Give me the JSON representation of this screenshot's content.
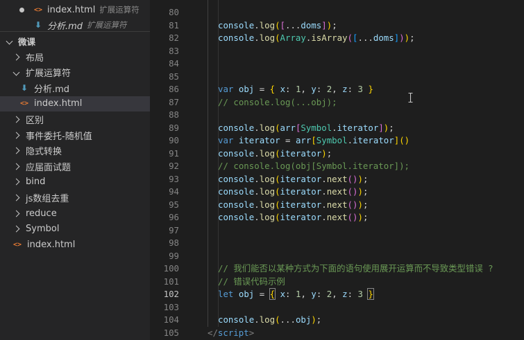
{
  "sidebar": {
    "open_editors": [
      {
        "name": "index.html",
        "description": "扩展运算符",
        "icon": "html-icon",
        "dirty": true
      },
      {
        "name": "分析.md",
        "description": "扩展运算符",
        "icon": "markdown-icon",
        "italic": true
      }
    ],
    "workspace_label": "微课",
    "tree": [
      {
        "label": "布局",
        "type": "folder",
        "expanded": false
      },
      {
        "label": "扩展运算符",
        "type": "folder",
        "expanded": true
      },
      {
        "label": "分析.md",
        "type": "file",
        "icon": "markdown-icon"
      },
      {
        "label": "index.html",
        "type": "file",
        "icon": "html-icon",
        "selected": true
      },
      {
        "label": "区别",
        "type": "folder",
        "expanded": false
      },
      {
        "label": "事件委托-随机值",
        "type": "folder",
        "expanded": false
      },
      {
        "label": "隐式转换",
        "type": "folder",
        "expanded": false
      },
      {
        "label": "应届面试题",
        "type": "folder",
        "expanded": false
      },
      {
        "label": "bind",
        "type": "folder",
        "expanded": false
      },
      {
        "label": "js数组去重",
        "type": "folder",
        "expanded": false
      },
      {
        "label": "reduce",
        "type": "folder",
        "expanded": false
      },
      {
        "label": "Symbol",
        "type": "folder",
        "expanded": false
      },
      {
        "label": "index.html",
        "type": "file",
        "icon": "html-icon"
      }
    ]
  },
  "editor": {
    "active_line": 102,
    "lines": [
      {
        "n": 80,
        "tokens": []
      },
      {
        "n": 81,
        "tokens": [
          [
            "console",
            "var"
          ],
          [
            ".",
            "plain"
          ],
          [
            "log",
            "fn"
          ],
          [
            "(",
            "b1"
          ],
          [
            "[",
            "b2"
          ],
          [
            "...",
            "plain"
          ],
          [
            "doms",
            "var"
          ],
          [
            "]",
            "b2"
          ],
          [
            ")",
            "b1"
          ],
          [
            ";",
            "plain"
          ]
        ]
      },
      {
        "n": 82,
        "tokens": [
          [
            "console",
            "var"
          ],
          [
            ".",
            "plain"
          ],
          [
            "log",
            "fn"
          ],
          [
            "(",
            "b1"
          ],
          [
            "Array",
            "type"
          ],
          [
            ".",
            "plain"
          ],
          [
            "isArray",
            "fn"
          ],
          [
            "(",
            "b2"
          ],
          [
            "[",
            "b3"
          ],
          [
            "...",
            "plain"
          ],
          [
            "doms",
            "var"
          ],
          [
            "]",
            "b3"
          ],
          [
            ")",
            "b2"
          ],
          [
            ")",
            "b1"
          ],
          [
            ";",
            "plain"
          ]
        ]
      },
      {
        "n": 83,
        "tokens": []
      },
      {
        "n": 84,
        "tokens": []
      },
      {
        "n": 85,
        "tokens": []
      },
      {
        "n": 86,
        "tokens": [
          [
            "var",
            "kw"
          ],
          [
            " ",
            "plain"
          ],
          [
            "obj",
            "var"
          ],
          [
            " = ",
            "plain"
          ],
          [
            "{",
            "b1"
          ],
          [
            " ",
            "plain"
          ],
          [
            "x",
            "var"
          ],
          [
            ": ",
            "plain"
          ],
          [
            "1",
            "num"
          ],
          [
            ", ",
            "plain"
          ],
          [
            "y",
            "var"
          ],
          [
            ": ",
            "plain"
          ],
          [
            "2",
            "num"
          ],
          [
            ", ",
            "plain"
          ],
          [
            "z",
            "var"
          ],
          [
            ": ",
            "plain"
          ],
          [
            "3",
            "num"
          ],
          [
            " ",
            "plain"
          ],
          [
            "}",
            "b1"
          ]
        ]
      },
      {
        "n": 87,
        "tokens": [
          [
            "// console.log(...obj);",
            "cm"
          ]
        ]
      },
      {
        "n": 88,
        "tokens": []
      },
      {
        "n": 89,
        "tokens": [
          [
            "console",
            "var"
          ],
          [
            ".",
            "plain"
          ],
          [
            "log",
            "fn"
          ],
          [
            "(",
            "b1"
          ],
          [
            "arr",
            "var"
          ],
          [
            "[",
            "b2"
          ],
          [
            "Symbol",
            "type"
          ],
          [
            ".",
            "plain"
          ],
          [
            "iterator",
            "var"
          ],
          [
            "]",
            "b2"
          ],
          [
            ")",
            "b1"
          ],
          [
            ";",
            "plain"
          ]
        ]
      },
      {
        "n": 90,
        "tokens": [
          [
            "var",
            "kw"
          ],
          [
            " ",
            "plain"
          ],
          [
            "iterator",
            "var"
          ],
          [
            " = ",
            "plain"
          ],
          [
            "arr",
            "var"
          ],
          [
            "[",
            "b1"
          ],
          [
            "Symbol",
            "type"
          ],
          [
            ".",
            "plain"
          ],
          [
            "iterator",
            "var"
          ],
          [
            "]",
            "b1"
          ],
          [
            "(",
            "b1"
          ],
          [
            ")",
            "b1"
          ]
        ]
      },
      {
        "n": 91,
        "tokens": [
          [
            "console",
            "var"
          ],
          [
            ".",
            "plain"
          ],
          [
            "log",
            "fn"
          ],
          [
            "(",
            "b1"
          ],
          [
            "iterator",
            "var"
          ],
          [
            ")",
            "b1"
          ],
          [
            ";",
            "plain"
          ]
        ]
      },
      {
        "n": 92,
        "tokens": [
          [
            "// console.log(obj[Symbol.iterator]);",
            "cm"
          ]
        ]
      },
      {
        "n": 93,
        "tokens": [
          [
            "console",
            "var"
          ],
          [
            ".",
            "plain"
          ],
          [
            "log",
            "fn"
          ],
          [
            "(",
            "b1"
          ],
          [
            "iterator",
            "var"
          ],
          [
            ".",
            "plain"
          ],
          [
            "next",
            "fn"
          ],
          [
            "(",
            "b2"
          ],
          [
            ")",
            "b2"
          ],
          [
            ")",
            "b1"
          ],
          [
            ";",
            "plain"
          ]
        ]
      },
      {
        "n": 94,
        "tokens": [
          [
            "console",
            "var"
          ],
          [
            ".",
            "plain"
          ],
          [
            "log",
            "fn"
          ],
          [
            "(",
            "b1"
          ],
          [
            "iterator",
            "var"
          ],
          [
            ".",
            "plain"
          ],
          [
            "next",
            "fn"
          ],
          [
            "(",
            "b2"
          ],
          [
            ")",
            "b2"
          ],
          [
            ")",
            "b1"
          ],
          [
            ";",
            "plain"
          ]
        ]
      },
      {
        "n": 95,
        "tokens": [
          [
            "console",
            "var"
          ],
          [
            ".",
            "plain"
          ],
          [
            "log",
            "fn"
          ],
          [
            "(",
            "b1"
          ],
          [
            "iterator",
            "var"
          ],
          [
            ".",
            "plain"
          ],
          [
            "next",
            "fn"
          ],
          [
            "(",
            "b2"
          ],
          [
            ")",
            "b2"
          ],
          [
            ")",
            "b1"
          ],
          [
            ";",
            "plain"
          ]
        ]
      },
      {
        "n": 96,
        "tokens": [
          [
            "console",
            "var"
          ],
          [
            ".",
            "plain"
          ],
          [
            "log",
            "fn"
          ],
          [
            "(",
            "b1"
          ],
          [
            "iterator",
            "var"
          ],
          [
            ".",
            "plain"
          ],
          [
            "next",
            "fn"
          ],
          [
            "(",
            "b2"
          ],
          [
            ")",
            "b2"
          ],
          [
            ")",
            "b1"
          ],
          [
            ";",
            "plain"
          ]
        ]
      },
      {
        "n": 97,
        "tokens": []
      },
      {
        "n": 98,
        "tokens": []
      },
      {
        "n": 99,
        "tokens": []
      },
      {
        "n": 100,
        "tokens": [
          [
            "// 我们能否以某种方式为下面的语句使用展开运算而不导致类型错误 ?",
            "cm"
          ]
        ]
      },
      {
        "n": 101,
        "tokens": [
          [
            "// 错误代码示例",
            "cm"
          ]
        ]
      },
      {
        "n": 102,
        "tokens": [
          [
            "let",
            "kw"
          ],
          [
            " ",
            "plain"
          ],
          [
            "obj",
            "var"
          ],
          [
            " = ",
            "plain"
          ],
          [
            "{",
            "b1bm"
          ],
          [
            " ",
            "plain"
          ],
          [
            "x",
            "var"
          ],
          [
            ": ",
            "plain"
          ],
          [
            "1",
            "num"
          ],
          [
            ", ",
            "plain"
          ],
          [
            "y",
            "var"
          ],
          [
            ": ",
            "plain"
          ],
          [
            "2",
            "num"
          ],
          [
            ", ",
            "plain"
          ],
          [
            "z",
            "var"
          ],
          [
            ": ",
            "plain"
          ],
          [
            "3",
            "num"
          ],
          [
            " ",
            "plain"
          ],
          [
            "}",
            "b1bm"
          ]
        ]
      },
      {
        "n": 103,
        "tokens": []
      },
      {
        "n": 104,
        "tokens": [
          [
            "console",
            "var"
          ],
          [
            ".",
            "plain"
          ],
          [
            "log",
            "fn"
          ],
          [
            "(",
            "b1"
          ],
          [
            "...",
            "plain"
          ],
          [
            "obj",
            "var"
          ],
          [
            ")",
            "b1"
          ],
          [
            ";",
            "plain"
          ]
        ]
      },
      {
        "n": 105,
        "tokens": [
          [
            "</",
            "tag"
          ],
          [
            "script",
            "tagn"
          ],
          [
            ">",
            "tag"
          ]
        ]
      }
    ]
  }
}
